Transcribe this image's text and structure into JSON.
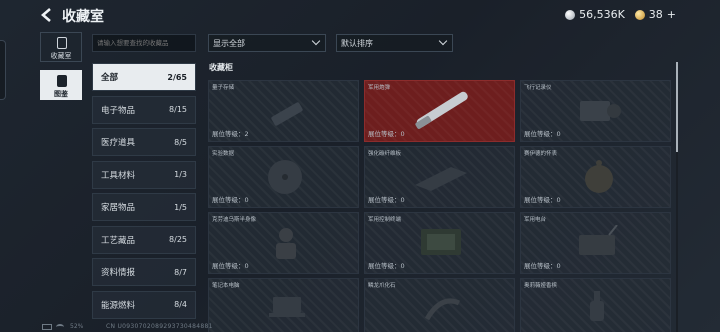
{
  "header": {
    "title": "收藏室"
  },
  "currency": {
    "silver_amount": "56,536K",
    "gold_amount": "38"
  },
  "side_tabs": [
    {
      "label": "收藏室",
      "icon": "collection-room-icon"
    },
    {
      "label": "图鉴",
      "icon": "catalog-book-icon"
    }
  ],
  "search": {
    "placeholder": "请输入想要查找的收藏品"
  },
  "filters": {
    "display": "显示全部",
    "sort": "默认排序"
  },
  "categories": [
    {
      "label": "全部",
      "count": "2/65"
    },
    {
      "label": "电子物品",
      "count": "8/15"
    },
    {
      "label": "医疗道具",
      "count": "8/5"
    },
    {
      "label": "工具材料",
      "count": "1/3"
    },
    {
      "label": "家居物品",
      "count": "1/5"
    },
    {
      "label": "工艺藏品",
      "count": "8/25"
    },
    {
      "label": "资料情报",
      "count": "8/7"
    },
    {
      "label": "能源燃料",
      "count": "8/4"
    }
  ],
  "section_title": "收藏柜",
  "items": [
    {
      "name": "量子存储",
      "level": "展位等级：2",
      "selected": false
    },
    {
      "name": "军用炮弹",
      "level": "展位等级：0",
      "selected": true
    },
    {
      "name": "飞行记录仪",
      "level": "展位等级：0",
      "selected": false
    },
    {
      "name": "实验数据",
      "level": "展位等级：0",
      "selected": false
    },
    {
      "name": "强化碳纤维板",
      "level": "展位等级：0",
      "selected": false
    },
    {
      "name": "赛伊德的怀表",
      "level": "展位等级：0",
      "selected": false
    },
    {
      "name": "克劳迪乌斯半身像",
      "level": "展位等级：0",
      "selected": false
    },
    {
      "name": "军用控制终端",
      "level": "展位等级：0",
      "selected": false
    },
    {
      "name": "军用电台",
      "level": "展位等级：0",
      "selected": false
    },
    {
      "name": "笔记本电脑",
      "level": "",
      "selected": false
    },
    {
      "name": "鳞龙爪化石",
      "level": "",
      "selected": false
    },
    {
      "name": "奥莉薇娅香槟",
      "level": "",
      "selected": false
    }
  ],
  "status": {
    "battery": "52%",
    "uid": "CN U0930702089293730484881"
  },
  "colors": {
    "selected_card": "#6e1e1e",
    "active_category": "#e8ecef",
    "background": "#1e2630"
  }
}
